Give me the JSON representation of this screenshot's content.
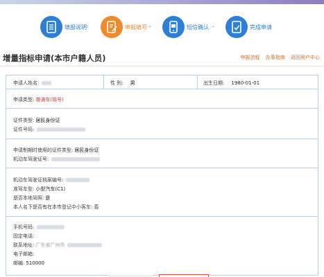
{
  "steps": [
    {
      "label": "填报说明",
      "color": "#2f7fd6"
    },
    {
      "label": "申报填写",
      "color": "#f08a2c"
    },
    {
      "label": "短信确认",
      "color": "#2f7fd6"
    },
    {
      "label": "完成申请",
      "color": "#2f7fd6"
    }
  ],
  "page": {
    "title": "增量指标申请(本市户籍人员)",
    "links": [
      "申报流程",
      "办事指南",
      "返回用户中心"
    ]
  },
  "form": {
    "applicant_name_label": "申请人姓名:",
    "gender_label": "性 别:",
    "gender_value": "男",
    "birth_label": "出生日期:",
    "birth_value": "1980-01-01",
    "apply_type_label": "申请类型:",
    "apply_type_value": "普通车(摇号)",
    "id_type_label": "证件类型:",
    "id_type_value": "居民身份证",
    "id_no_label": "证件号码:",
    "apply_id_type_label": "申请制期时使用的证件类型:",
    "apply_id_type_value": "居民身份证",
    "license_no_label": "机动车驾驶证号:",
    "archive_no_label": "机动车驾驶证档案编号:",
    "class_label": "准驾车型:",
    "class_value": "小型汽车(C1)",
    "local_label": "是否本地驾照:",
    "local_value": "是",
    "registered_label": "本人名下是否有在本市登记中小客车:",
    "registered_value": "否",
    "phone_label": "手机号码:",
    "landline_label": "固定电话:",
    "address_label": "联系地址:",
    "address_prefix": "广东省广州市",
    "email_label": "电子邮箱:",
    "zip_label": "邮编:",
    "zip_value": "510000"
  },
  "colors": {
    "accent_blue": "#2f7fd6",
    "accent_orange": "#f08a2c",
    "link_orange": "#e0702a",
    "border": "#b9cfe6",
    "highlight_red": "#d33333"
  }
}
